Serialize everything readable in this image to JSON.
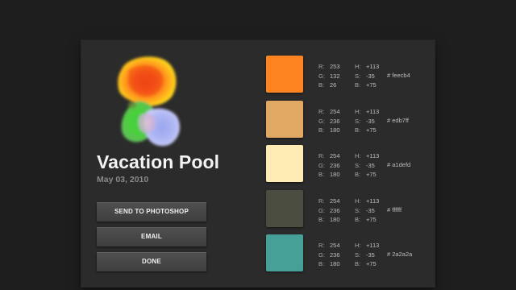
{
  "theme": {
    "page_bg": "#1e1e1e",
    "panel_bg": "#2b2b2b",
    "title_color": "#f2f2f2",
    "date_color": "#8a8a8a"
  },
  "theme_info": {
    "title": "Vacation Pool",
    "date": "May 03, 2010"
  },
  "buttons": {
    "send_to_photoshop": "SEND TO PHOTOSHOP",
    "email": "EMAIL",
    "done": "DONE"
  },
  "colors": [
    {
      "swatch": "#fd8420",
      "r_label": "R:",
      "r": "253",
      "g_label": "G:",
      "g": "132",
      "b_label": "B:",
      "b": "26",
      "h_label": "H:",
      "h": "+113",
      "s_label": "S:",
      "s": "-35",
      "br_label": "B:",
      "br": "+75",
      "hex": "# feecb4"
    },
    {
      "swatch": "#e0a862",
      "r_label": "R:",
      "r": "254",
      "g_label": "G:",
      "g": "236",
      "b_label": "B:",
      "b": "180",
      "h_label": "H:",
      "h": "+113",
      "s_label": "S:",
      "s": "-35",
      "br_label": "B:",
      "br": "+75",
      "hex": "# edb7ff"
    },
    {
      "swatch": "#ffecb4",
      "r_label": "R:",
      "r": "254",
      "g_label": "G:",
      "g": "236",
      "b_label": "B:",
      "b": "180",
      "h_label": "H:",
      "h": "+113",
      "s_label": "S:",
      "s": "-35",
      "br_label": "B:",
      "br": "+75",
      "hex": "# a1defd"
    },
    {
      "swatch": "#4b4d40",
      "r_label": "R:",
      "r": "254",
      "g_label": "G:",
      "g": "236",
      "b_label": "B:",
      "b": "180",
      "h_label": "H:",
      "h": "+113",
      "s_label": "S:",
      "s": "-35",
      "br_label": "B:",
      "br": "+75",
      "hex": "# ffffff"
    },
    {
      "swatch": "#46a097",
      "r_label": "R:",
      "r": "254",
      "g_label": "G:",
      "g": "236",
      "b_label": "B:",
      "b": "180",
      "h_label": "H:",
      "h": "+113",
      "s_label": "S:",
      "s": "-35",
      "br_label": "B:",
      "br": "+75",
      "hex": "# 2a2a2a"
    }
  ]
}
